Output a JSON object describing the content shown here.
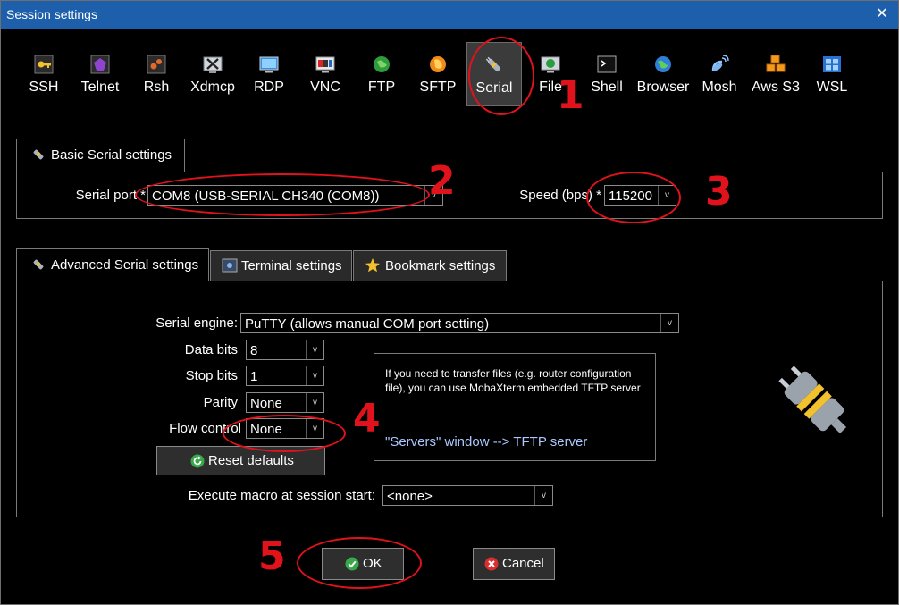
{
  "window": {
    "title": "Session settings",
    "close_glyph": "✕"
  },
  "session_types": [
    {
      "label": "SSH",
      "icon": "key-icon"
    },
    {
      "label": "Telnet",
      "icon": "telnet-icon"
    },
    {
      "label": "Rsh",
      "icon": "rsh-icon"
    },
    {
      "label": "Xdmcp",
      "icon": "xdmcp-icon"
    },
    {
      "label": "RDP",
      "icon": "rdp-icon"
    },
    {
      "label": "VNC",
      "icon": "vnc-icon"
    },
    {
      "label": "FTP",
      "icon": "globe-icon"
    },
    {
      "label": "SFTP",
      "icon": "sftp-icon"
    },
    {
      "label": "Serial",
      "icon": "serial-plug-icon",
      "selected": true
    },
    {
      "label": "File",
      "icon": "file-icon"
    },
    {
      "label": "Shell",
      "icon": "terminal-icon"
    },
    {
      "label": "Browser",
      "icon": "browser-globe-icon"
    },
    {
      "label": "Mosh",
      "icon": "satellite-icon"
    },
    {
      "label": "Aws S3",
      "icon": "cubes-icon"
    },
    {
      "label": "WSL",
      "icon": "windows-icon"
    }
  ],
  "basic": {
    "tab_label": "Basic Serial settings",
    "serial_port_label": "Serial port *",
    "serial_port_value": "COM8  (USB-SERIAL CH340 (COM8))",
    "speed_label": "Speed (bps) *",
    "speed_value": "115200"
  },
  "advanced": {
    "tabs": [
      {
        "label": "Advanced Serial settings",
        "active": true
      },
      {
        "label": "Terminal settings",
        "active": false
      },
      {
        "label": "Bookmark settings",
        "active": false
      }
    ],
    "serial_engine_label": "Serial engine:",
    "serial_engine_value": "PuTTY    (allows manual COM port setting)",
    "data_bits_label": "Data bits",
    "data_bits_value": "8",
    "stop_bits_label": "Stop bits",
    "stop_bits_value": "1",
    "parity_label": "Parity",
    "parity_value": "None",
    "flow_control_label": "Flow control",
    "flow_control_value": "None",
    "reset_label": "Reset defaults",
    "macro_label": "Execute macro at session start:",
    "macro_value": "<none>",
    "info_text": "If you need to transfer files (e.g. router configuration file), you can use MobaXterm embedded TFTP server",
    "info_link": "\"Servers\" window  -->  TFTP server"
  },
  "buttons": {
    "ok": "OK",
    "cancel": "Cancel"
  },
  "annotations": [
    "1",
    "2",
    "3",
    "4",
    "5"
  ],
  "colors": {
    "titlebar": "#1d5fab",
    "annotation": "#e0121b",
    "ok_green": "#3aa84a",
    "cancel_red": "#d83030",
    "info_link": "#a9c8ff"
  }
}
